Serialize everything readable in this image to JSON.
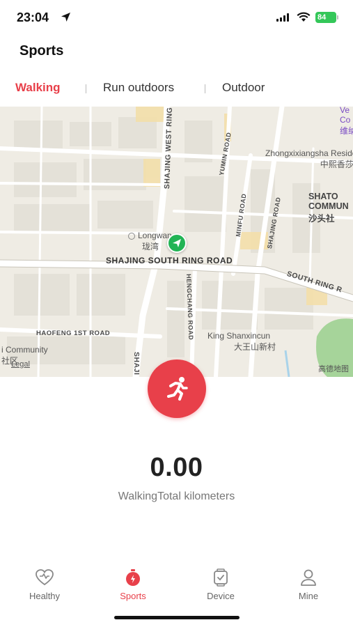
{
  "status_bar": {
    "time": "23:04",
    "battery": "84"
  },
  "header": {
    "title": "Sports"
  },
  "tabs": [
    {
      "label": "Walking",
      "active": true
    },
    {
      "label": "Run outdoors",
      "active": false
    },
    {
      "label": "Outdoor",
      "active": false
    }
  ],
  "map": {
    "roads": [
      "SHAJING WEST RING",
      "YUMIN ROAD",
      "MINFU ROAD",
      "SHAJING ROAD",
      "SHAJING SOUTH RING ROAD",
      "SOUTH RING R",
      "HENGCHANG ROAD",
      "HAOFENG 1ST ROAD",
      "SHAJI"
    ],
    "pois": [
      {
        "name": "Longwan",
        "name_cn": "珑湾"
      },
      {
        "name": "Zhongxixiangsha Residence",
        "name_cn": "中熙香莎公馆"
      },
      {
        "name": "King Shanxincun",
        "name_cn": "大王山新村"
      },
      {
        "name": "SHATO COMMUN",
        "name_cn": "沙头社"
      },
      {
        "name": "i Community",
        "name_cn": "社区"
      },
      {
        "name": "Ve Co",
        "name_cn": "维纳"
      }
    ],
    "provider": "高德地图",
    "legal": "Legal"
  },
  "stats": {
    "distance_value": "0.00",
    "distance_label": "WalkingTotal kilometers"
  },
  "bottom_nav": [
    {
      "label": "Healthy",
      "icon": "heart-icon",
      "active": false
    },
    {
      "label": "Sports",
      "icon": "stopwatch-icon",
      "active": true
    },
    {
      "label": "Device",
      "icon": "watch-icon",
      "active": false
    },
    {
      "label": "Mine",
      "icon": "person-icon",
      "active": false
    }
  ],
  "colors": {
    "accent": "#e8404a",
    "location_marker": "#22b455",
    "battery": "#34c759"
  }
}
